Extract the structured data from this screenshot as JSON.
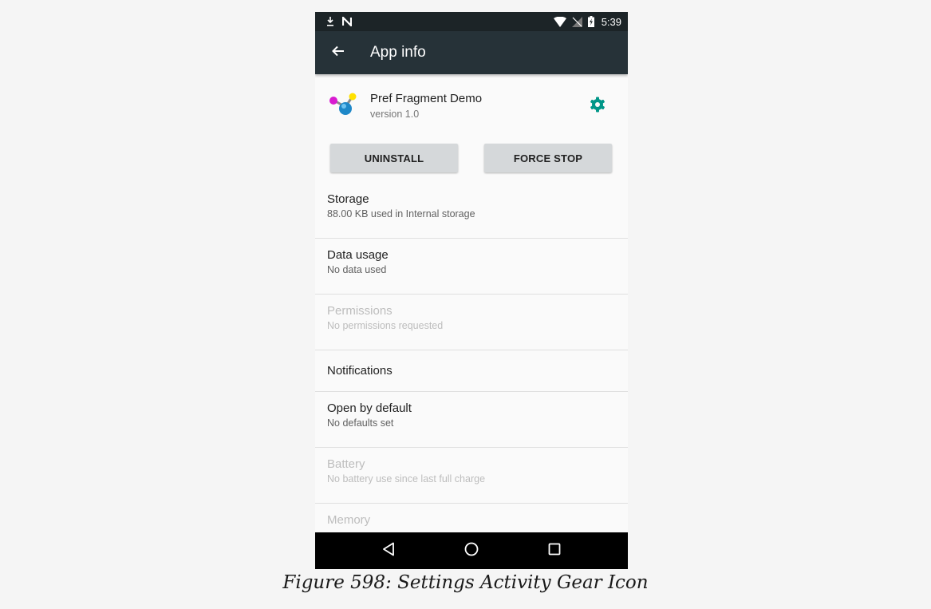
{
  "status_bar": {
    "time": "5:39",
    "left_icons": [
      "download-icon",
      "n-icon"
    ],
    "right_icons": [
      "wifi-icon",
      "no-signal-icon",
      "battery-charging-icon"
    ]
  },
  "toolbar": {
    "title": "App info",
    "back_icon": "arrow-back-icon"
  },
  "app": {
    "name": "Pref Fragment Demo",
    "version": "version 1.0",
    "settings_icon": "gear-icon"
  },
  "buttons": {
    "uninstall": "UNINSTALL",
    "force_stop": "FORCE STOP"
  },
  "prefs": [
    {
      "title": "Storage",
      "subtitle": "88.00 KB used in Internal storage",
      "enabled": true
    },
    {
      "title": "Data usage",
      "subtitle": "No data used",
      "enabled": true
    },
    {
      "title": "Permissions",
      "subtitle": "No permissions requested",
      "enabled": false
    },
    {
      "title": "Notifications",
      "subtitle": "",
      "enabled": true
    },
    {
      "title": "Open by default",
      "subtitle": "No defaults set",
      "enabled": true
    },
    {
      "title": "Battery",
      "subtitle": "No battery use since last full charge",
      "enabled": false
    },
    {
      "title": "Memory",
      "subtitle": "",
      "enabled": false
    }
  ],
  "nav": [
    "back-icon",
    "home-icon",
    "recents-icon"
  ],
  "caption": "Figure 598: Settings Activity Gear Icon",
  "colors": {
    "toolbar": "#263238",
    "status_bar": "#1c2427",
    "accent": "#009688"
  }
}
